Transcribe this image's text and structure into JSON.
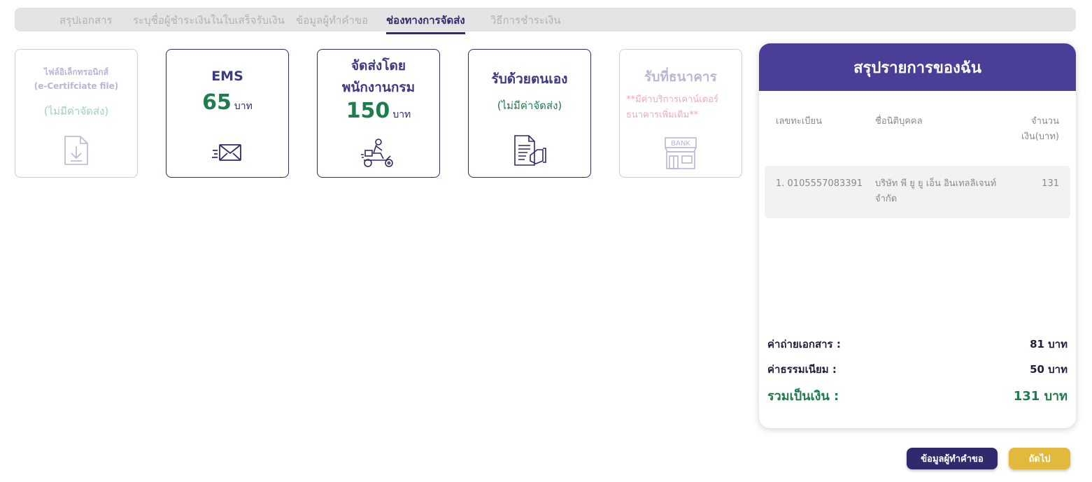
{
  "steps": [
    {
      "label": "สรุปเอกสาร",
      "active": false
    },
    {
      "label": "ระบุชื่อผู้ชำระเงินในใบเสร็จรับเงิน",
      "active": false
    },
    {
      "label": "ข้อมูลผู้ทำคำขอ",
      "active": false
    },
    {
      "label": "ช่องทางการจัดส่ง",
      "active": true
    },
    {
      "label": "วิธีการชำระเงิน",
      "active": false
    }
  ],
  "cards": {
    "efile": {
      "title_line1": "ไฟล์อิเล็กทรอนิกส์",
      "title_line2": "(e-Certifciate file)",
      "fee_note": "(ไม่มีค่าจัดส่ง)",
      "icon": "file-download-icon",
      "disabled": true
    },
    "ems": {
      "title": "EMS",
      "price": "65",
      "unit": "บาท",
      "icon": "envelope-icon"
    },
    "messenger": {
      "title_line1": "จัดส่งโดย",
      "title_line2": "พนักงานกรม",
      "price": "150",
      "unit": "บาท",
      "icon": "scooter-courier-icon"
    },
    "pickup": {
      "title": "รับด้วยตนเอง",
      "fee_note": "(ไม่มีค่าจัดส่ง)",
      "icon": "document-hand-icon"
    },
    "bank": {
      "title": "รับที่ธนาคาร",
      "note_line1": "**มีค่าบริการเคาน์เตอร์",
      "note_line2": "ธนาคารเพิ่มเติม**",
      "icon": "bank-building-icon",
      "icon_text": "BANK",
      "disabled": true
    }
  },
  "summary": {
    "title": "สรุปรายการของฉัน",
    "columns": {
      "reg_no": "เลขทะเบียน",
      "name": "ชื่อนิติบุคคล",
      "amount_line1": "จำนวน",
      "amount_line2": "เงิน(บาท)"
    },
    "rows": [
      {
        "reg_no": "1. 0105557083391",
        "name_line1": "บริษัท พี ยู ยู เอ็น อินเทลลิเจนท์",
        "name_line2": "จำกัด",
        "amount": "131"
      }
    ],
    "copy_fee_label": "ค่าถ่ายเอกสาร :",
    "copy_fee_value": "81 บาท",
    "service_fee_label": "ค่าธรรมเนียม :",
    "service_fee_value": "50 บาท",
    "total_label": "รวมเป็นเงิน :",
    "total_value": "131 บาท"
  },
  "buttons": {
    "back": "ข้อมูลผู้ทำคำขอ",
    "next": "ถัดไป"
  },
  "colors": {
    "primary": "#2e2a6b",
    "header": "#4a3f96",
    "green": "#1e7d4c",
    "accent": "#e2b93b"
  }
}
